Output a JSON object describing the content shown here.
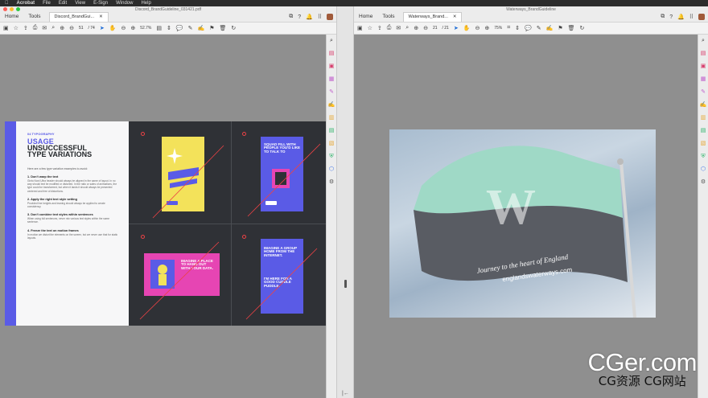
{
  "menubar": {
    "app_icon": "apple-icon",
    "app": "Acrobat",
    "items": [
      "File",
      "Edit",
      "View",
      "E-Sign",
      "Window",
      "Help"
    ]
  },
  "left_window": {
    "title": "Discord_BrandGuideline_031421.pdf",
    "nav_home": "Home",
    "nav_tools": "Tools",
    "tab_label": "Discord_BrandGui...",
    "page_current": "51",
    "page_total": "/ 74",
    "zoom": "52.7%",
    "doc": {
      "subhead": "04 TYPOGRAPHY",
      "heading_accent": "USAGE",
      "heading_1": "UNSUCCESSFUL",
      "heading_2": "TYPE VARIATIONS",
      "intro": "Here are a few type variation examples to avoid:",
      "items": [
        {
          "title": "1. Don't warp the text",
          "desc": "Ginto Nord Ultra header should always be aligned in the same of layout. In no way should text be modified or distorted. In the ratio or sales of animations, the type could be transformed, but when it lands it should always be presented centered and free of distortions."
        },
        {
          "title": "2. Apply the right text style setting",
          "desc": "Provided line heights and leaning should always be applied to create consistency."
        },
        {
          "title": "3. Don't combine text styles within sentences",
          "desc": "When using full sentences, never mix various text styles within the same sentence."
        },
        {
          "title": "4. Freeze the text on motion frames",
          "desc": "In motion we distort the elements on the screen, but we never use that for static layouts."
        }
      ],
      "card2_text": "SQUAD FILL WITH PEOPLE YOU'D LIKE TO TALK TO",
      "card3_text": "IMAGINE A PLACE TO HANG OUT WITH YOUR DATA.",
      "card4_text": "IMAGINE A GROUP HOME FROM THE INTERNET.",
      "card4_text2": "I'M HERE FOR A GOOD CUDDLE PUDDLE."
    }
  },
  "right_window": {
    "title": "Waterways_BrandGuideline",
    "nav_home": "Home",
    "nav_tools": "Tools",
    "tab_label": "Waterways_Brand...",
    "page_current": "21",
    "page_total": "/ 21",
    "zoom": "75%",
    "flag": {
      "letter": "W",
      "tagline": "Journey to the heart of England",
      "url": "englandswaterways.com"
    }
  },
  "watermark": {
    "line1": "CGer.com",
    "line2": "CG资源 CG网站"
  },
  "colors": {
    "discord_blurple": "#5a5be6",
    "discord_dark": "#2f3136",
    "discord_yellow": "#f3e25a",
    "discord_pink": "#e645b3",
    "flag_mint": "#9fd9c6",
    "flag_grey": "#595c63"
  }
}
